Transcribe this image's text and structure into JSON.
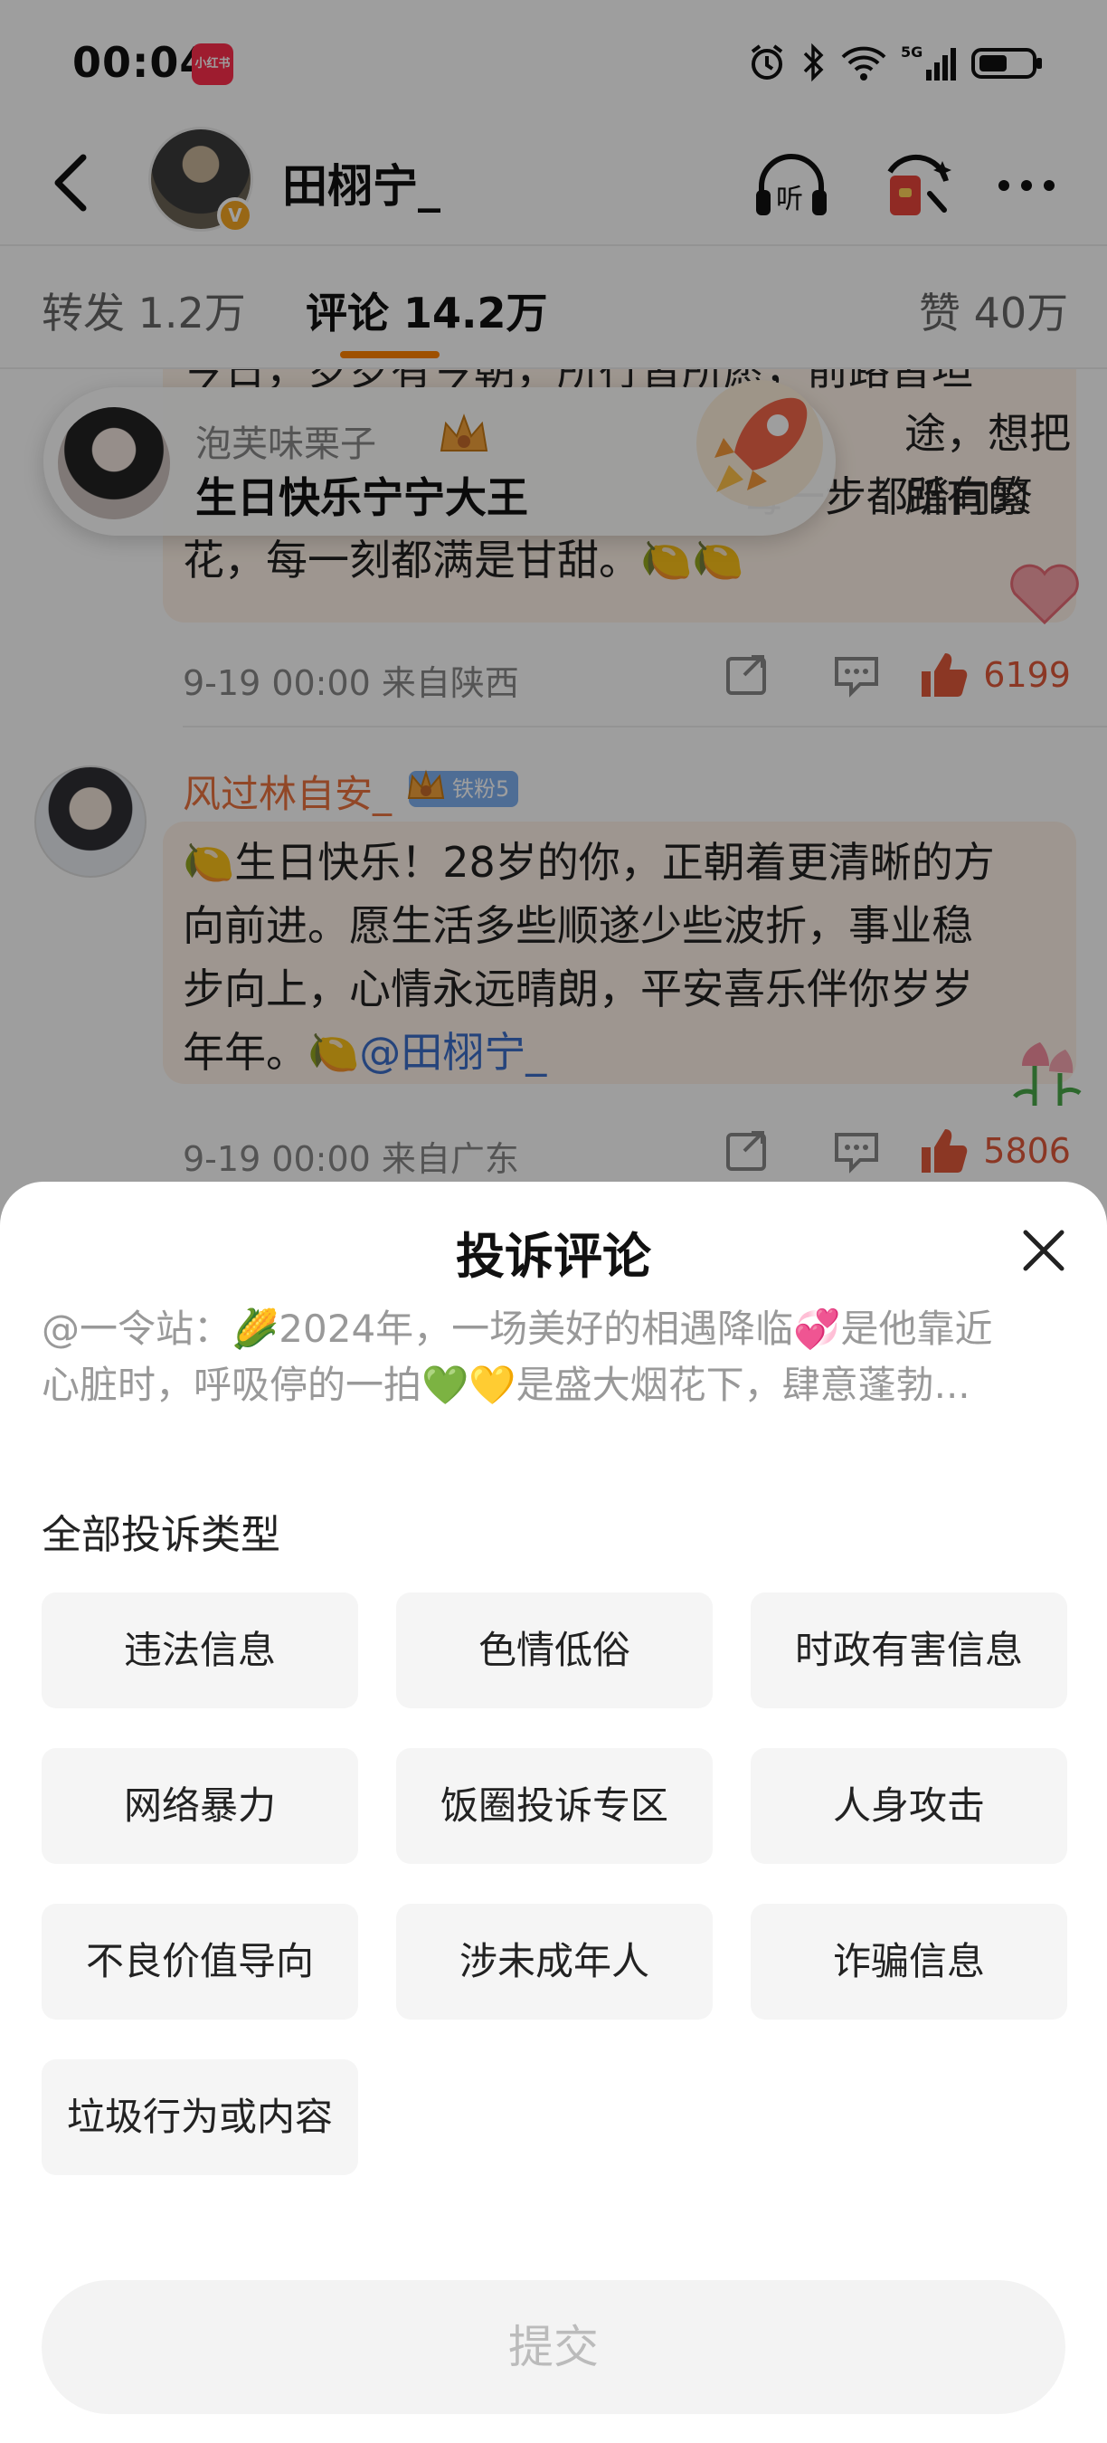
{
  "status_bar": {
    "time": "00:04",
    "app_badge": "小红书"
  },
  "header": {
    "back_icon": "chevron-left-icon",
    "username": "田栩宁_",
    "vip_badge": "V",
    "listen_label": "听"
  },
  "tabs": [
    {
      "label": "转发 1.2万",
      "active": false
    },
    {
      "label": "评论 14.2万",
      "active": true
    },
    {
      "label": "赞 40万",
      "active": false
    }
  ],
  "comment1": {
    "lines": [
      "今日，岁岁有今朝，所行皆所愿，前路皆坦",
      "途，想把所有的",
      "每一步都踏向繁",
      "花，每一刻都满是甘甜。🍋🍋"
    ],
    "meta": "9-19 00:00  来自陕西",
    "likes": "6199"
  },
  "floating_pill": {
    "user": "泡芙味栗子",
    "text": "生日快乐宁宁大王"
  },
  "comment2": {
    "user": "风过林自安_",
    "fan_badge": "铁粉5",
    "lines": [
      "🍋生日快乐！28岁的你，正朝着更清晰的方",
      "向前进。愿生活多些顺遂少些波折，事业稳",
      "步向上，心情永远晴朗，平安喜乐伴你岁岁",
      "年年。🍋"
    ],
    "mention": "@田栩宁_",
    "meta": "9-19 00:00  来自广东",
    "likes": "5806"
  },
  "sheet": {
    "title": "投诉评论",
    "quote_line1": "@一令站：🌽2024年，一场美好的相遇降临💞是他靠近",
    "quote_line2": "心脏时，呼吸停的一拍💚💛是盛大烟花下，肆意蓬勃...",
    "section_label": "全部投诉类型",
    "options": [
      "违法信息",
      "色情低俗",
      "时政有害信息",
      "网络暴力",
      "饭圈投诉专区",
      "人身攻击",
      "不良价值导向",
      "涉未成年人",
      "诈骗信息",
      "垃圾行为或内容"
    ],
    "submit_label": "提交"
  }
}
